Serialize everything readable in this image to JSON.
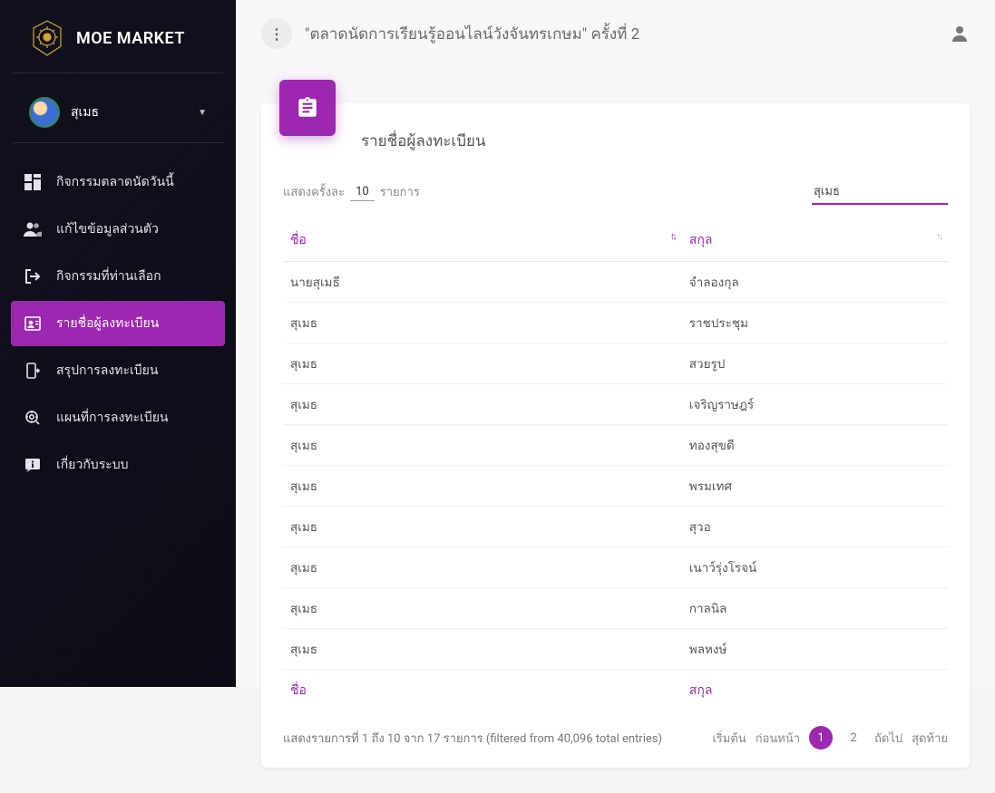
{
  "brand": {
    "title": "MOE MARKET"
  },
  "user": {
    "name": "สุเมธ"
  },
  "nav": {
    "items": [
      {
        "label": "กิจกรรมตลาดนัดวันนี้"
      },
      {
        "label": "แก้ไขข้อมูลส่วนตัว"
      },
      {
        "label": "กิจกรรมที่ท่านเลือก"
      },
      {
        "label": "รายชื่อผู้ลงทะเบียน"
      },
      {
        "label": "สรุปการลงทะเบียน"
      },
      {
        "label": "แผนที่การลงทะเบียน"
      },
      {
        "label": "เกี่ยวกับระบบ"
      }
    ]
  },
  "header": {
    "title": "\"ตลาดนัดการเรียนรู้ออนไลน์วังจันทรเกษม\" ครั้งที่ 2"
  },
  "card": {
    "title": "รายชื่อผู้ลงทะเบียน",
    "page_size_label": "แสดงครั้งละ",
    "page_size_value": "10",
    "page_size_suffix": "รายการ",
    "search_value": "สุเมธ"
  },
  "table": {
    "columns": [
      "ชื่อ",
      "สกุล"
    ],
    "rows": [
      {
        "first": "นายสุเมธี",
        "last": "จำลองกุล"
      },
      {
        "first": "สุเมธ",
        "last": "ราชประชุม"
      },
      {
        "first": "สุเมธ",
        "last": "สวยรูป"
      },
      {
        "first": "สุเมธ",
        "last": "เจริญราษฎร์"
      },
      {
        "first": "สุเมธ",
        "last": "ทองสุขดี"
      },
      {
        "first": "สุเมธ",
        "last": "พรมเทศ"
      },
      {
        "first": "สุเมธ",
        "last": "สุวอ"
      },
      {
        "first": "สุเมธ",
        "last": "เนาว์รุ่งโรจน์"
      },
      {
        "first": "สุเมธ",
        "last": "กาลนิล"
      },
      {
        "first": "สุเมธ",
        "last": "พลหงษ์"
      }
    ],
    "info": "แสดงรายการที่ 1 ถึง 10 จาก 17 รายการ (filtered from 40,096 total entries)"
  },
  "pagination": {
    "first": "เริ่มต้น",
    "prev": "ก่อนหน้า",
    "pages": [
      "1",
      "2"
    ],
    "active": "1",
    "next": "ถัดไป",
    "last": "สุดท้าย"
  }
}
